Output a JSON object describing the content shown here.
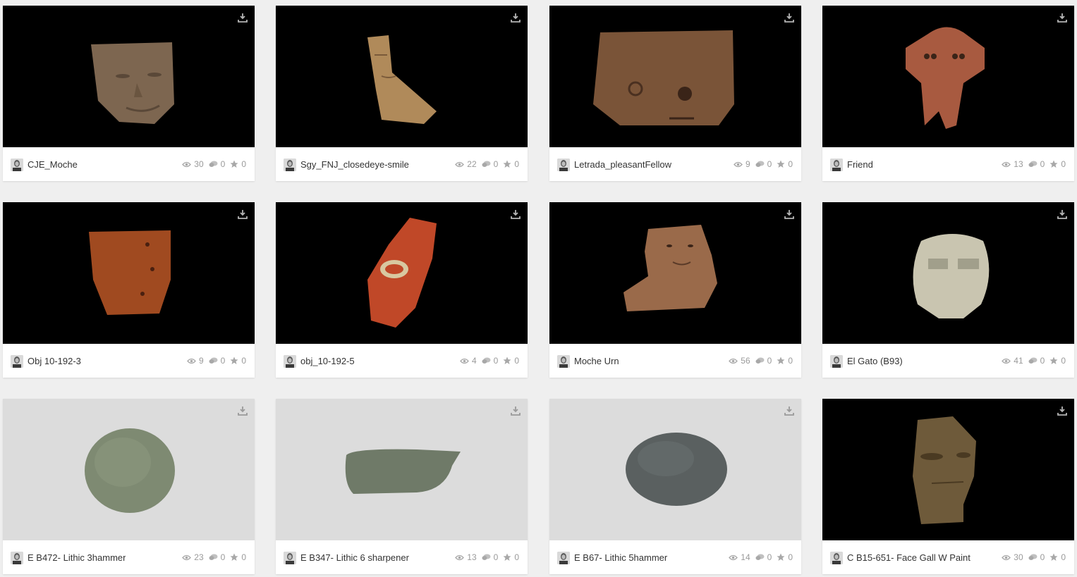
{
  "models": [
    {
      "title": "CJE_Moche",
      "views": "30",
      "comments": "0",
      "likes": "0",
      "bg": "dark",
      "art": "face-tan",
      "color": "#7d6650"
    },
    {
      "title": "Sgy_FNJ_closedeye-smile",
      "views": "22",
      "comments": "0",
      "likes": "0",
      "bg": "dark",
      "art": "shard-beige",
      "color": "#b08a5a"
    },
    {
      "title": "Letrada_pleasantFellow",
      "views": "9",
      "comments": "0",
      "likes": "0",
      "bg": "dark",
      "art": "pot-brown",
      "color": "#7a5438"
    },
    {
      "title": "Friend",
      "views": "13",
      "comments": "0",
      "likes": "0",
      "bg": "dark",
      "art": "figure-red",
      "color": "#a85a40"
    },
    {
      "title": "Obj 10-192-3",
      "views": "9",
      "comments": "0",
      "likes": "0",
      "bg": "dark",
      "art": "pot-orange",
      "color": "#a04a20"
    },
    {
      "title": "obj_10-192-5",
      "views": "4",
      "comments": "0",
      "likes": "0",
      "bg": "dark",
      "art": "shard-red",
      "color": "#c04828"
    },
    {
      "title": "Moche Urn",
      "views": "56",
      "comments": "0",
      "likes": "0",
      "bg": "dark",
      "art": "urn",
      "color": "#9a6a4a"
    },
    {
      "title": "El Gato (B93)",
      "views": "41",
      "comments": "0",
      "likes": "0",
      "bg": "dark",
      "art": "cat-head",
      "color": "#c9c5b0"
    },
    {
      "title": "E B472- Lithic 3hammer",
      "views": "23",
      "comments": "0",
      "likes": "0",
      "bg": "light",
      "art": "stone-round",
      "color": "#7e8a72"
    },
    {
      "title": "E B347- Lithic 6 sharpener",
      "views": "13",
      "comments": "0",
      "likes": "0",
      "bg": "light",
      "art": "stone-long",
      "color": "#6f7a68"
    },
    {
      "title": "E B67- Lithic 5hammer",
      "views": "14",
      "comments": "0",
      "likes": "0",
      "bg": "light",
      "art": "stone-oval",
      "color": "#5a6060"
    },
    {
      "title": "C B15-651- Face Gall W Paint",
      "views": "30",
      "comments": "0",
      "likes": "0",
      "bg": "dark",
      "art": "face-olive",
      "color": "#6e5a3a"
    }
  ]
}
